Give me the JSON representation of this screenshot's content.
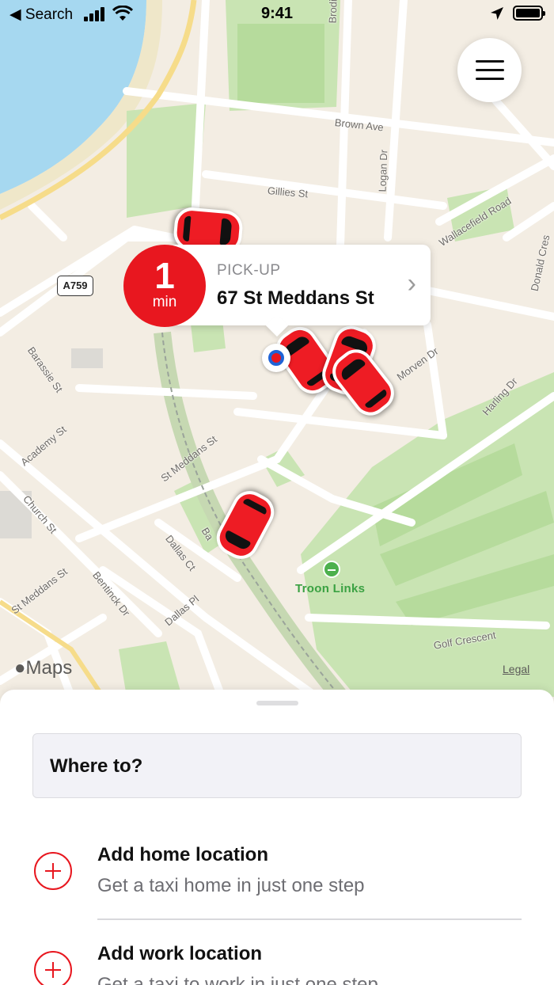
{
  "status_bar": {
    "back_label": "◀ Search",
    "time": "9:41",
    "icons": [
      "cellular-signal-icon",
      "wifi-icon",
      "location-arrow-icon",
      "battery-icon"
    ]
  },
  "map": {
    "road_shield": "A759",
    "streets": {
      "brodie": "Brodie",
      "brown_ave": "Brown Ave",
      "logan_dr": "Logan Dr",
      "gillies_st": "Gillies St",
      "wallacefield_road": "Wallacefield Road",
      "donald_cres": "Donald Cres",
      "barassie_st": "Barassie St",
      "morven_dr": "Morven Dr",
      "harling_dr": "Harling Dr",
      "academy_st": "Academy St",
      "st_meddans_st": "St Meddans St",
      "church_st": "Church St",
      "dallas_ct": "Dallas Ct",
      "st_meddans_st_2": "St Meddans St",
      "bentinck_dr": "Bentinck Dr",
      "dallas_pl": "Dallas Pl",
      "golf_crescent": "Golf Crescent",
      "ba": "Ba"
    },
    "poi": "Troon Links",
    "maps_logo": "Maps",
    "legal": "Legal",
    "colors": {
      "land": "#f3ede3",
      "water": "#a6d8f0",
      "park": "#c9e4b3",
      "road": "#ffffff",
      "rail": "#b9c9a9",
      "brand_red": "#ee1c24"
    }
  },
  "pickup": {
    "eta_value": "1",
    "eta_unit": "min",
    "label": "PICK-UP",
    "address": "67 St Meddans St"
  },
  "sheet": {
    "search_placeholder": "Where to?",
    "items": [
      {
        "title": "Add home location",
        "subtitle": "Get a taxi home in just one step"
      },
      {
        "title": "Add work location",
        "subtitle": "Get a taxi to work in just one step"
      }
    ]
  }
}
